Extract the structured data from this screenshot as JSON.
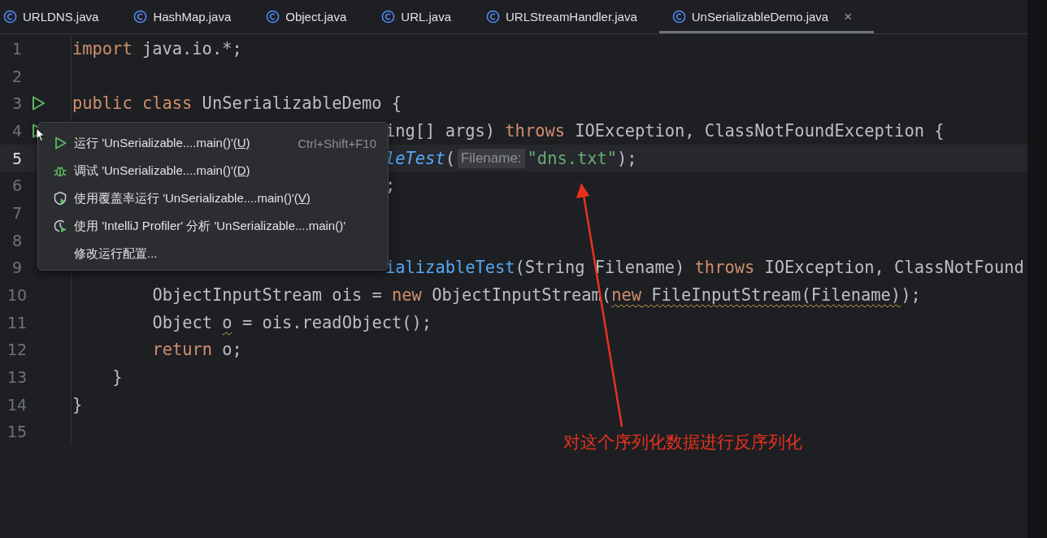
{
  "tabs": [
    {
      "label": "URLDNS.java",
      "selected": false
    },
    {
      "label": "HashMap.java",
      "selected": false
    },
    {
      "label": "Object.java",
      "selected": false
    },
    {
      "label": "URL.java",
      "selected": false
    },
    {
      "label": "URLStreamHandler.java",
      "selected": false
    },
    {
      "label": "UnSerializableDemo.java",
      "selected": true,
      "close": "×"
    }
  ],
  "editor": {
    "lines": [
      {
        "number": "1",
        "tokens": [
          {
            "kind": "kw",
            "text": "import"
          },
          {
            "kind": "plain",
            "text": " java.io.*;"
          }
        ]
      },
      {
        "number": "2"
      },
      {
        "number": "3",
        "run_icon": true,
        "tokens": [
          {
            "kind": "kw",
            "text": "public class"
          },
          {
            "kind": "plain",
            "text": " UnSerializableDemo {"
          }
        ],
        "children": [
          {
            "number": "4",
            "run_icon": true,
            "covered": true,
            "tokens": [
              {
                "kind": "plain",
                "text": "ing[] args) "
              },
              {
                "kind": "kw",
                "text": "throws"
              },
              {
                "kind": "plain",
                "text": " IOException, ClassNotFoundException {"
              }
            ],
            "children": [
              {
                "number": "5",
                "covered": true,
                "current": true,
                "tokens": [
                  {
                    "kind": "call",
                    "text": "leTest"
                  },
                  {
                    "kind": "plain",
                    "text": "("
                  },
                  {
                    "kind": "hint",
                    "text": "Filename:"
                  },
                  {
                    "kind": "str",
                    "text": "\"dns.txt\""
                  },
                  {
                    "kind": "plain",
                    "text": ");"
                  }
                ]
              },
              {
                "number": "6",
                "covered": true,
                "tokens": [
                  {
                    "kind": "plain",
                    "text": ";"
                  }
                ]
              }
            ]
          },
          {
            "number": "7"
          },
          {
            "number": "8"
          },
          {
            "number": "9",
            "covered": true,
            "tokens": [
              {
                "kind": "decl",
                "text": "ializableTest"
              },
              {
                "kind": "plain",
                "text": "(String Filename) "
              },
              {
                "kind": "kw",
                "text": "throws"
              },
              {
                "kind": "plain",
                "text": " IOException, ClassNotFound"
              }
            ],
            "children": [
              {
                "number": "10",
                "tokens": [
                  {
                    "kind": "plain",
                    "text": "ObjectInputStream ois = "
                  },
                  {
                    "kind": "kw",
                    "text": "new"
                  },
                  {
                    "kind": "plain",
                    "text": " ObjectInputStream("
                  },
                  {
                    "kind": "kw",
                    "text": "new",
                    "warn": true
                  },
                  {
                    "kind": "plain",
                    "text": " FileInputStream(Filename)",
                    "warn": true
                  },
                  {
                    "kind": "plain",
                    "text": ");"
                  }
                ]
              },
              {
                "number": "11",
                "tokens": [
                  {
                    "kind": "plain",
                    "text": "Object "
                  },
                  {
                    "kind": "plain",
                    "text": "o",
                    "warn": true
                  },
                  {
                    "kind": "plain",
                    "text": " = ois.readObject();"
                  }
                ]
              },
              {
                "number": "12",
                "tokens": [
                  {
                    "kind": "kw",
                    "text": "return"
                  },
                  {
                    "kind": "plain",
                    "text": " o;"
                  }
                ]
              }
            ]
          },
          {
            "number": "13",
            "tokens": [
              {
                "kind": "plain",
                "text": "}"
              }
            ]
          }
        ]
      },
      {
        "number": "14",
        "tokens": [
          {
            "kind": "plain",
            "text": "}"
          }
        ]
      },
      {
        "number": "15"
      }
    ]
  },
  "popup_menu": {
    "items": [
      {
        "kind": "run",
        "label": "运行 'UnSerializable....main()'",
        "mnemonic": "(U)",
        "shortcut": "Ctrl+Shift+F10"
      },
      {
        "kind": "debug",
        "label": "调试 'UnSerializable....main()'",
        "mnemonic": "(D)"
      },
      {
        "kind": "coverage",
        "label": "使用覆盖率运行 'UnSerializable....main()'",
        "mnemonic": "(V)"
      },
      {
        "kind": "profiler",
        "label": "使用 'IntelliJ Profiler' 分析  'UnSerializable....main()'"
      },
      {
        "kind": "plain",
        "label": "修改运行配置..."
      }
    ]
  },
  "annotation": {
    "text": "对这个序列化数据进行反序列化"
  }
}
